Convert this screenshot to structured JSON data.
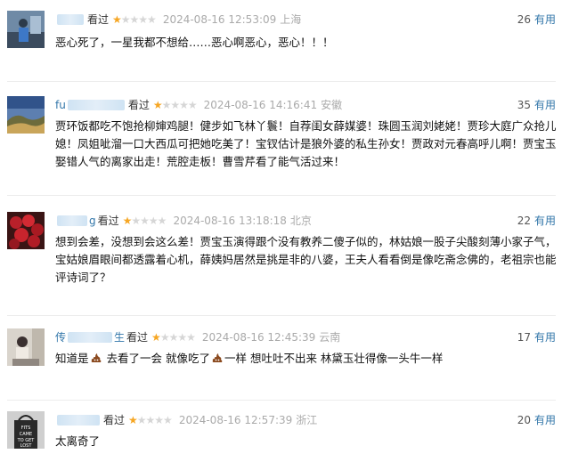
{
  "reviews": [
    {
      "username_visible": "",
      "username_suffix": "",
      "watched_label": "看过",
      "rating": 1,
      "rating_max": 5,
      "time": "2024-08-16 12:53:09",
      "location": "上海",
      "useful_count": "26",
      "useful_label": "有用",
      "content": "恶心死了，一星我都不想给……恶心啊恶心，恶心！！！",
      "avatar": "blue-figure-icon"
    },
    {
      "username_visible": "fu",
      "username_suffix": "",
      "watched_label": "看过",
      "rating": 1,
      "rating_max": 5,
      "time": "2024-08-16 14:16:41",
      "location": "安徽",
      "useful_count": "35",
      "useful_label": "有用",
      "content": "贾环饭都吃不饱抢柳婶鸡腿！健步如飞林丫鬟！自荐闺女薛媒婆！珠圆玉润刘姥姥！贾珍大庭广众抢儿媳！凤姐呲溜一口大西瓜可把她吃美了！宝钗估计是狼外婆的私生孙女！贾政对元春高呼儿啊！贾宝玉娶错人气的离家出走！荒腔走板！曹雪芹看了能气活过来！",
      "avatar": "landscape-icon"
    },
    {
      "username_visible": "",
      "username_suffix": "g",
      "watched_label": "看过",
      "rating": 1,
      "rating_max": 5,
      "time": "2024-08-16 13:18:18",
      "location": "北京",
      "useful_count": "22",
      "useful_label": "有用",
      "content": "想到会差，没想到会这么差！贾宝玉演得跟个没有教养二傻子似的，林姑娘一股子尖酸刻薄小家子气，宝姑娘眉眼间都透露着心机，薛姨妈居然是挑是非的八婆，王夫人看看倒是像吃斋念佛的，老祖宗也能评诗词了？",
      "avatar": "roses-icon"
    },
    {
      "username_visible": "传",
      "username_suffix": "生",
      "watched_label": "看过",
      "rating": 1,
      "rating_max": 5,
      "time": "2024-08-16 12:45:39",
      "location": "云南",
      "useful_count": "17",
      "useful_label": "有用",
      "content_parts": [
        "知道是",
        " 去看了一会 就像吃了",
        "一样 想吐吐不出来 林黛玉壮得像一头牛一样"
      ],
      "avatar": "person-photo-icon"
    },
    {
      "username_visible": "",
      "username_suffix": "",
      "watched_label": "看过",
      "rating": 1,
      "rating_max": 5,
      "time": "2024-08-16 12:57:39",
      "location": "浙江",
      "useful_count": "20",
      "useful_label": "有用",
      "content": "太离奇了",
      "avatar": "tote-bag-icon"
    }
  ],
  "avatar_text": "FITS CAME TO GET LOST"
}
